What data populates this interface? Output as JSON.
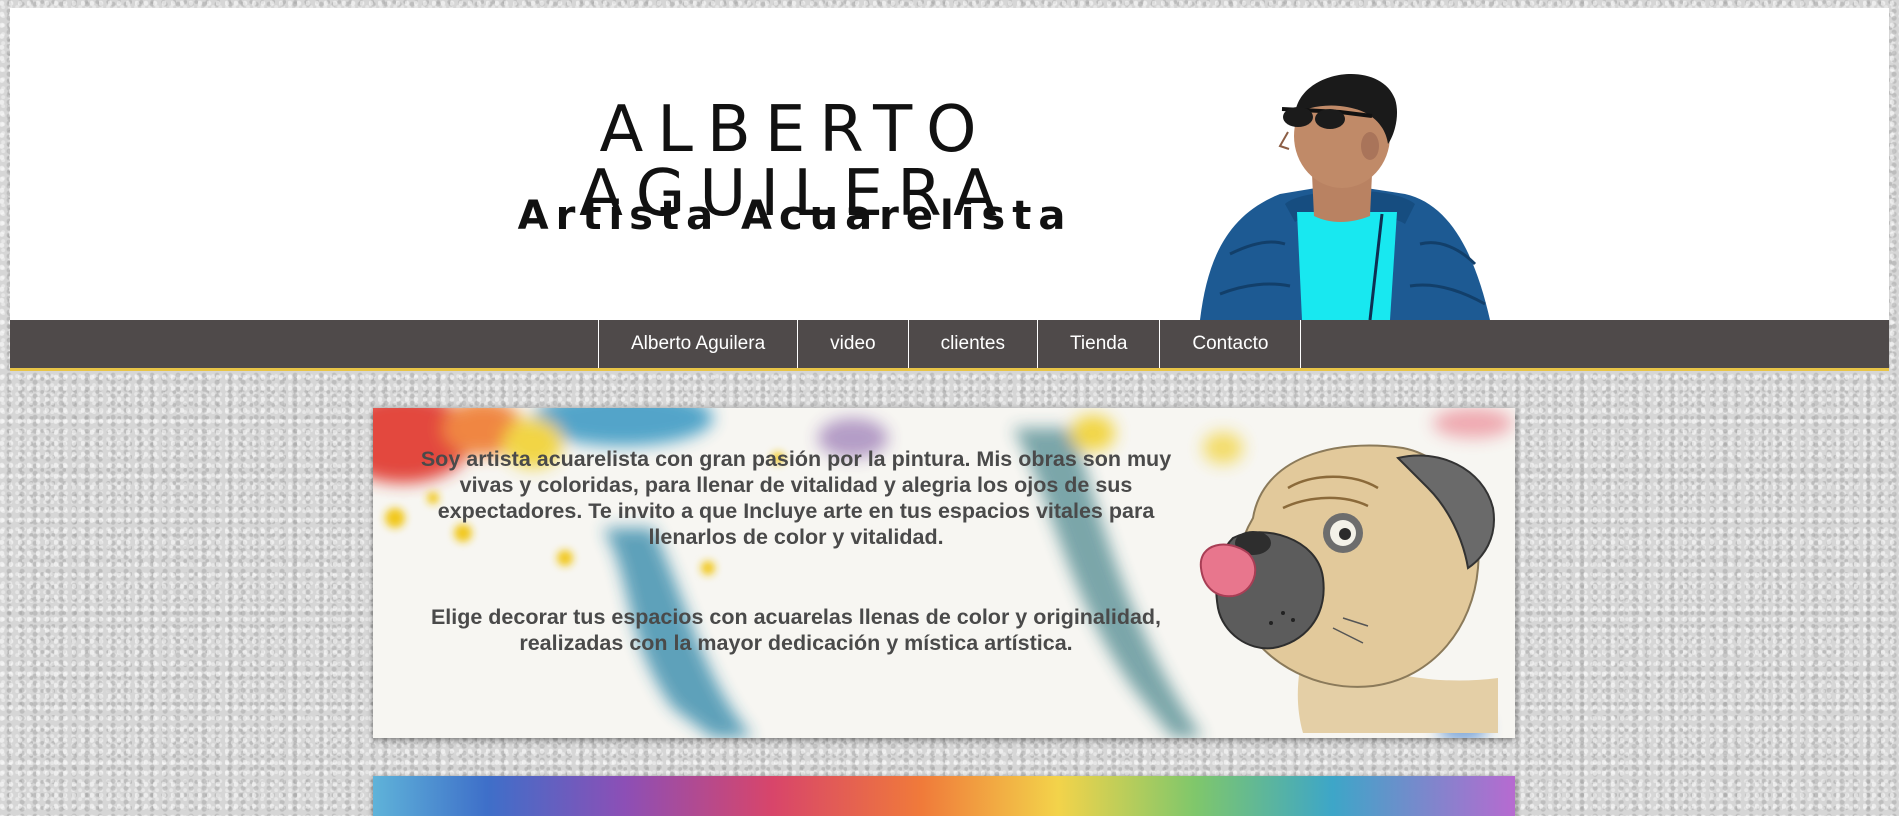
{
  "header": {
    "site_name": "ALBERTO AGUILERA",
    "tagline": "Artista Acuarelista"
  },
  "nav": {
    "items": [
      "Alberto Aguilera",
      "video",
      "clientes",
      "Tienda",
      "Contacto"
    ]
  },
  "intro": {
    "paragraph_1": "Soy artista acuarelista con gran pasión por la pintura. Mis obras son muy vivas y coloridas, para llenar de vitalidad y alegria los ojos de sus expectadores. Te invito a que Incluye arte en tus espacios vitales para llenarlos de color y vitalidad.",
    "paragraph_2": "Elige decorar tus espacios con acuarelas llenas de color y originalidad, realizadas con la mayor dedicación y mística artística."
  },
  "colors": {
    "nav_background": "#4f4a4a",
    "nav_underline": "#e8c548",
    "text_gray": "#4a4a4a"
  }
}
